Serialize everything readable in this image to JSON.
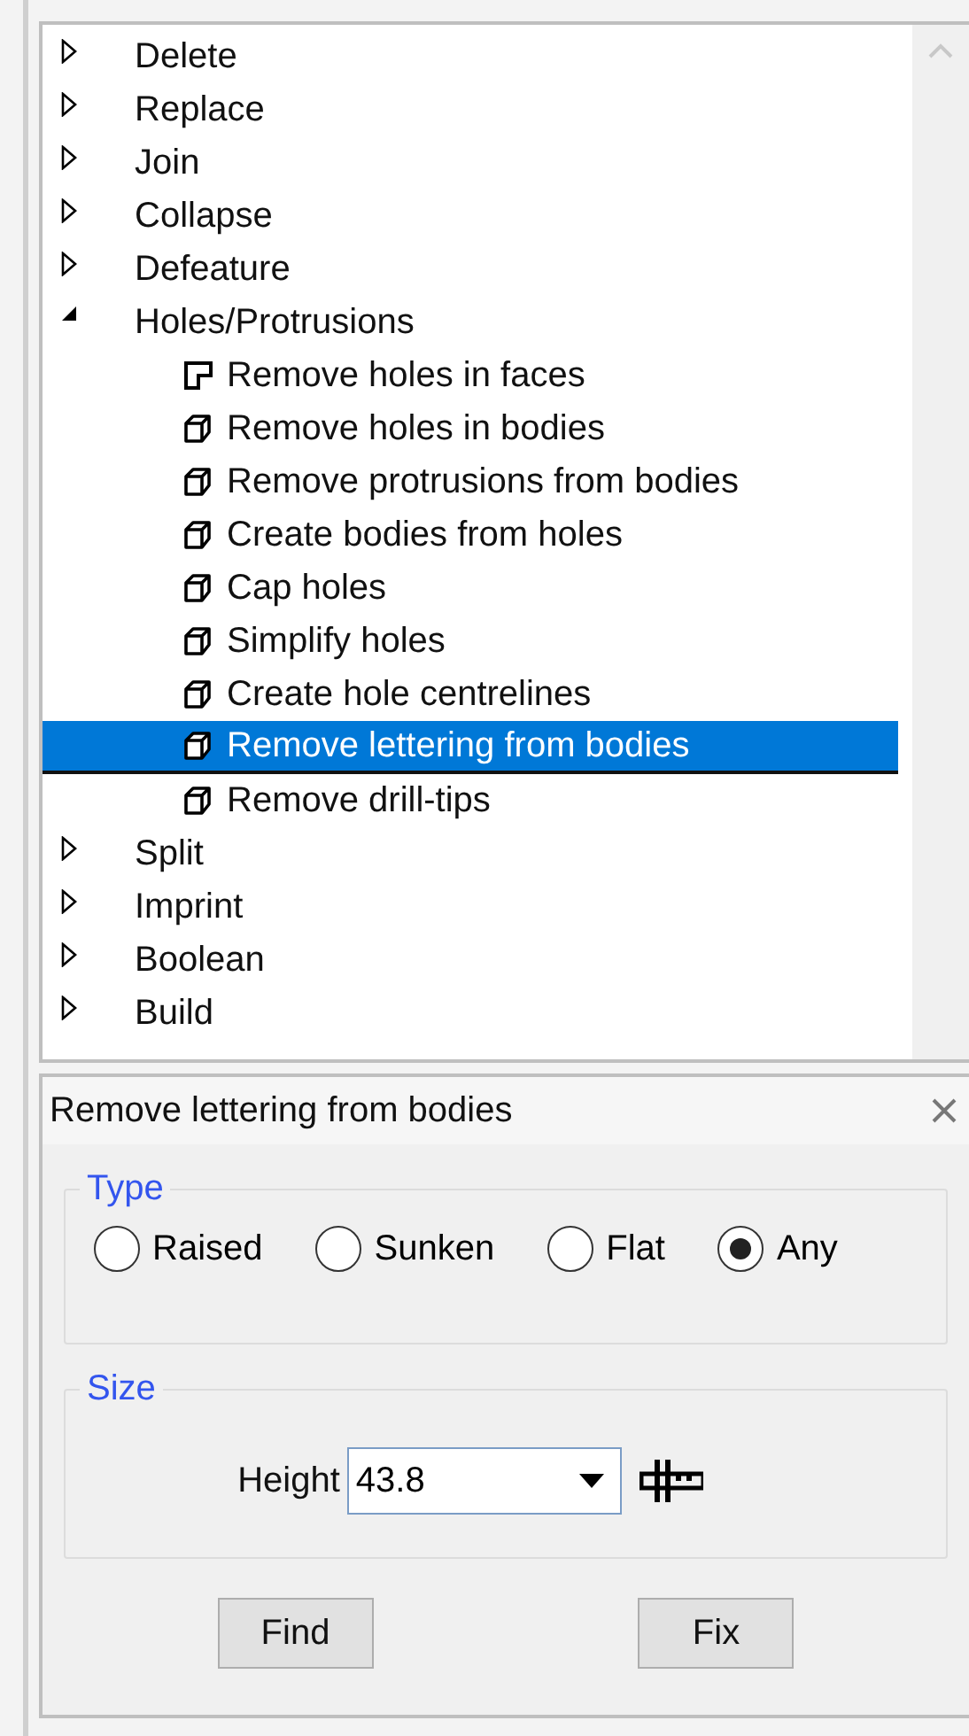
{
  "tree": [
    {
      "label": "Delete",
      "expanded": false
    },
    {
      "label": "Replace",
      "expanded": false
    },
    {
      "label": "Join",
      "expanded": false
    },
    {
      "label": "Collapse",
      "expanded": false
    },
    {
      "label": "Defeature",
      "expanded": false
    },
    {
      "label": "Holes/Protrusions",
      "expanded": true,
      "children": [
        {
          "label": "Remove holes in faces",
          "kind": "face",
          "selected": false
        },
        {
          "label": "Remove holes in bodies",
          "kind": "body",
          "selected": false
        },
        {
          "label": "Remove protrusions from bodies",
          "kind": "body",
          "selected": false
        },
        {
          "label": "Create bodies from holes",
          "kind": "body",
          "selected": false
        },
        {
          "label": "Cap holes",
          "kind": "body",
          "selected": false
        },
        {
          "label": "Simplify holes",
          "kind": "body",
          "selected": false
        },
        {
          "label": "Create hole centrelines",
          "kind": "body",
          "selected": false
        },
        {
          "label": "Remove lettering from bodies",
          "kind": "body",
          "selected": true
        },
        {
          "label": "Remove drill-tips",
          "kind": "body",
          "selected": false
        }
      ]
    },
    {
      "label": "Split",
      "expanded": false
    },
    {
      "label": "Imprint",
      "expanded": false
    },
    {
      "label": "Boolean",
      "expanded": false
    },
    {
      "label": "Build",
      "expanded": false
    }
  ],
  "panel": {
    "title": "Remove lettering from bodies",
    "type_group": {
      "legend": "Type",
      "options": [
        {
          "label": "Raised",
          "selected": false
        },
        {
          "label": "Sunken",
          "selected": false
        },
        {
          "label": "Flat",
          "selected": false
        },
        {
          "label": "Any",
          "selected": true
        }
      ]
    },
    "size_group": {
      "legend": "Size",
      "height_label": "Height",
      "height_value": "43.8"
    },
    "buttons": [
      "Find",
      "Fix"
    ]
  }
}
